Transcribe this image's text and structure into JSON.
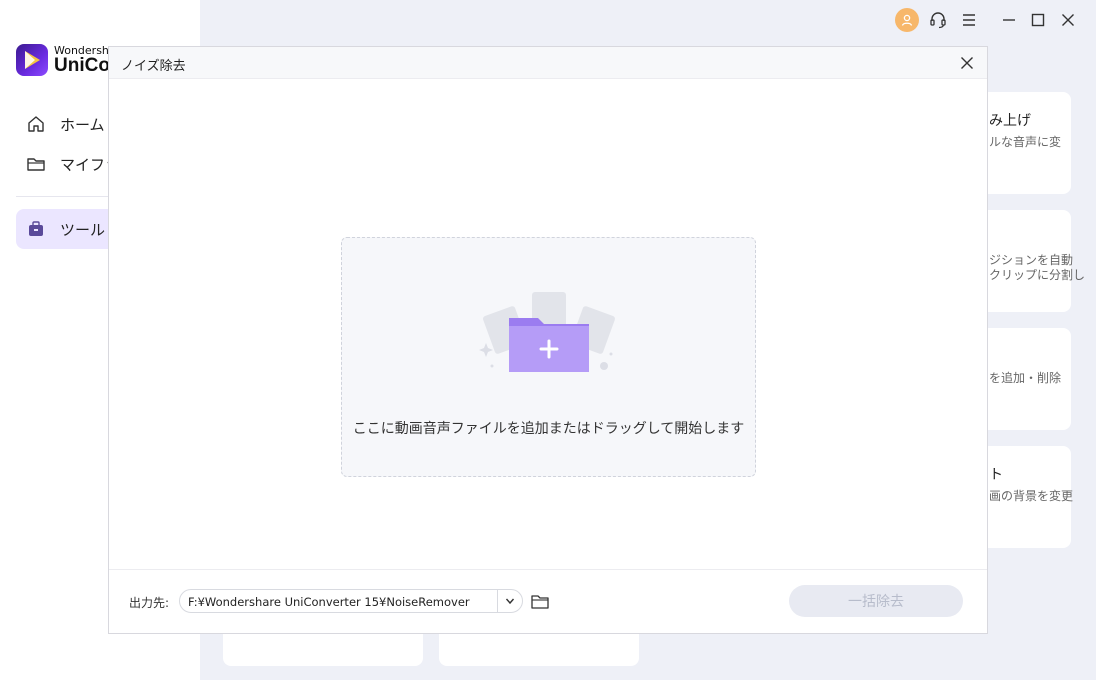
{
  "app": {
    "brand_top": "Wondershare",
    "brand_main": "UniCo",
    "accent": "#7b5cff"
  },
  "sidebar": {
    "items": [
      {
        "label": "ホーム",
        "icon": "home-icon"
      },
      {
        "label": "マイファイ",
        "icon": "folder-icon"
      },
      {
        "label": "ツール",
        "icon": "toolbox-icon",
        "active": true
      }
    ]
  },
  "background_cards": [
    {
      "title": "み上げ",
      "desc": [
        "ルな音声に変"
      ]
    },
    {
      "title": "",
      "desc": [
        "ジションを自動",
        "クリップに分割し"
      ]
    },
    {
      "title": "",
      "desc": [
        "を追加・削除"
      ]
    },
    {
      "title": "ト",
      "desc": [
        "画の背景を変更"
      ]
    }
  ],
  "modal": {
    "title": "ノイズ除去",
    "dropzone_text": "ここに動画音声ファイルを追加またはドラッグして開始します",
    "output_label": "出力先:",
    "output_path": "F:¥Wondershare UniConverter 15¥NoiseRemover",
    "batch_button": "一括除去"
  }
}
